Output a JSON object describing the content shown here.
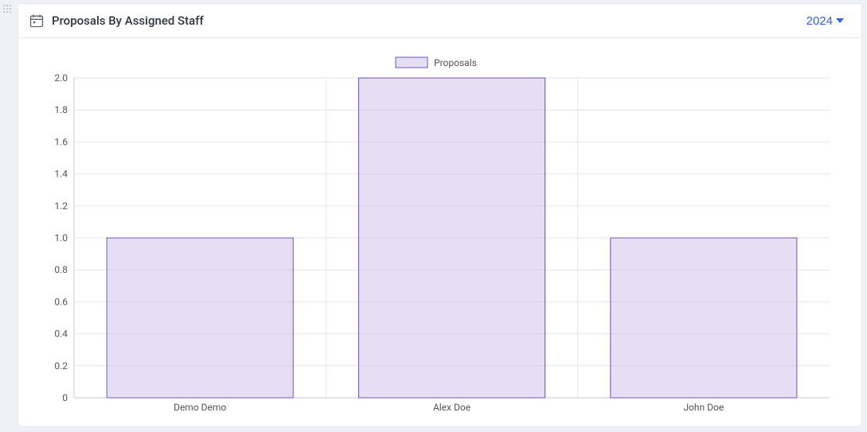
{
  "header": {
    "title": "Proposals By Assigned Staff",
    "year": "2024"
  },
  "chart_data": {
    "type": "bar",
    "title": "",
    "xlabel": "",
    "ylabel": "",
    "categories": [
      "Demo Demo",
      "Alex Doe",
      "John Doe"
    ],
    "series": [
      {
        "name": "Proposals",
        "values": [
          1,
          2,
          1
        ]
      }
    ],
    "ylim": [
      0,
      2
    ],
    "ytick_step": 0.2,
    "grid": true,
    "legend_position": "top",
    "colors": {
      "bar_fill": "#e2d8f3",
      "bar_stroke": "#6f56b7"
    }
  }
}
